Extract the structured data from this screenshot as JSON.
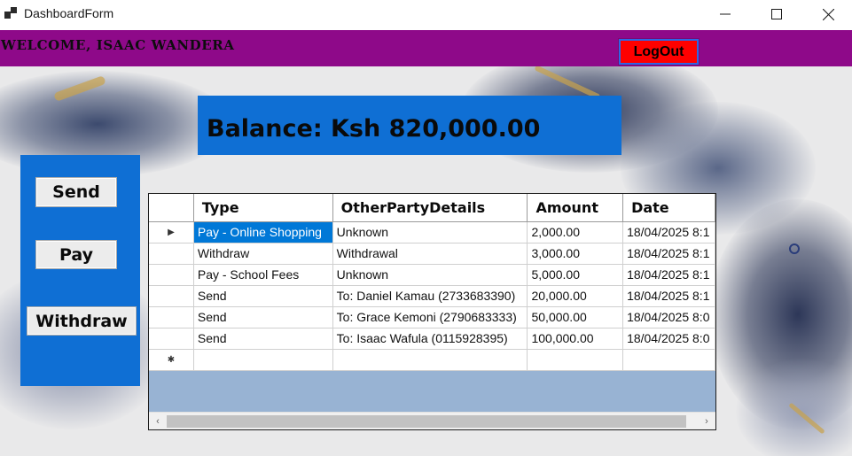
{
  "window": {
    "title": "DashboardForm",
    "icon": "app-window-icon",
    "controls": {
      "minimize": "—",
      "maximize": "☐",
      "close": "✕"
    }
  },
  "header": {
    "welcome": "WELCOME, ISAAC WANDERA",
    "logout_label": "LogOut",
    "bg_color": "#8e0989",
    "logout_color": "#ff0000"
  },
  "balance": {
    "text": "Balance: Ksh 820,000.00",
    "bg_color": "#0f6fd4"
  },
  "side_panel": {
    "send_label": "Send",
    "pay_label": "Pay",
    "withdraw_label": "Withdraw"
  },
  "transactions": {
    "columns": [
      "Type",
      "OtherPartyDetails",
      "Amount",
      "Date"
    ],
    "rows": [
      [
        "Pay - Online Shopping",
        "Unknown",
        "2,000.00",
        "18/04/2025 8:1"
      ],
      [
        "Withdraw",
        "Withdrawal",
        "3,000.00",
        "18/04/2025 8:1"
      ],
      [
        "Pay - School Fees",
        "Unknown",
        "5,000.00",
        "18/04/2025 8:1"
      ],
      [
        "Send",
        "To: Daniel Kamau (2733683390)",
        "20,000.00",
        "18/04/2025 8:1"
      ],
      [
        "Send",
        "To: Grace Kemoni (2790683333)",
        "50,000.00",
        "18/04/2025 8:0"
      ],
      [
        "Send",
        "To: Isaac Wafula (0115928395)",
        "100,000.00",
        "18/04/2025 8:0"
      ]
    ],
    "current_row_marker": "▶",
    "new_row_marker": "✱",
    "selection_color": "#0078d7",
    "scroll_left_icon": "‹",
    "scroll_right_icon": "›"
  }
}
